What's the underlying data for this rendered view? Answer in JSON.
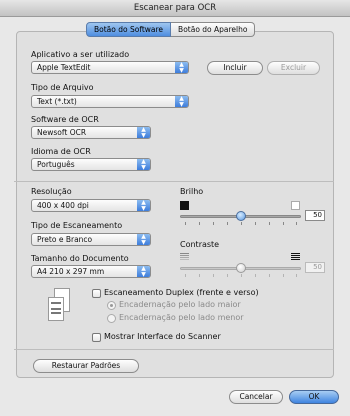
{
  "window": {
    "title": "Escanear para OCR"
  },
  "tabs": [
    {
      "label": "Botão do Software",
      "active": true
    },
    {
      "label": "Botão do Aparelho",
      "active": false
    }
  ],
  "app_section": {
    "label": "Aplicativo a ser utilizado",
    "value": "Apple TextEdit",
    "add_label": "Incluir",
    "remove_label": "Excluir"
  },
  "file_type": {
    "label": "Tipo de Arquivo",
    "value": "Text (*.txt)"
  },
  "ocr_software": {
    "label": "Software de OCR",
    "value": "Newsoft OCR"
  },
  "ocr_language": {
    "label": "Idioma de OCR",
    "value": "Português"
  },
  "resolution": {
    "label": "Resolução",
    "value": "400 x 400 dpi"
  },
  "scan_type": {
    "label": "Tipo de Escaneamento",
    "value": "Preto e Branco"
  },
  "document_size": {
    "label": "Tamanho do Documento",
    "value": "A4  210 x 297 mm"
  },
  "brightness": {
    "label": "Brilho",
    "value": "50",
    "level_percent": 50
  },
  "contrast": {
    "label": "Contraste",
    "value": "50",
    "level_percent": 50,
    "enabled": false
  },
  "duplex": {
    "label": "Escaneamento Duplex (frente e verso)",
    "checked": false,
    "options": [
      "Encadernação pelo lado maior",
      "Encadernação pelo lado menor"
    ]
  },
  "show_interface": {
    "label": "Mostrar Interface do Scanner",
    "checked": false
  },
  "restore_label": "Restaurar Padrões",
  "cancel_label": "Cancelar",
  "ok_label": "OK",
  "colors": {
    "accent": "#3f84e0",
    "panel": "#e0e0e0"
  }
}
